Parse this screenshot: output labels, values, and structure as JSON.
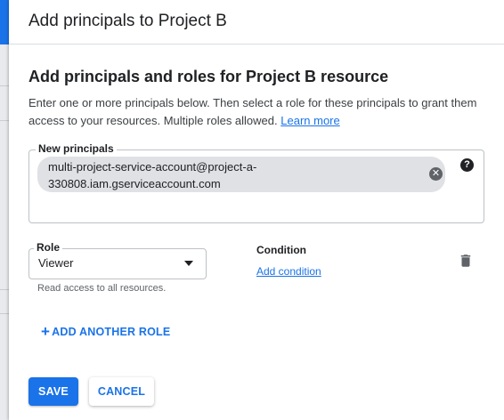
{
  "dialog": {
    "title": "Add principals to Project B"
  },
  "section": {
    "heading": "Add principals and roles for Project B resource",
    "description": "Enter one or more principals below. Then select a role for these principals to grant them access to your resources. Multiple roles allowed.",
    "learn_more": "Learn more"
  },
  "principals": {
    "label": "New principals",
    "chip_value": "multi-project-service-account@project-a-330808.iam.gserviceaccount.com",
    "chip_line1": "multi-project-service-account@project-a-",
    "chip_line2": "330808.iam.gserviceaccount.com",
    "remove_icon": "close-circle-icon",
    "help_icon": "help-icon"
  },
  "role": {
    "label": "Role",
    "value": "Viewer",
    "hint": "Read access to all resources."
  },
  "condition": {
    "label": "Condition",
    "add_link": "Add condition"
  },
  "actions": {
    "add_role": "ADD ANOTHER ROLE",
    "save": "SAVE",
    "cancel": "CANCEL"
  },
  "colors": {
    "accent": "#1a73e8",
    "chip_bg": "#dfe1e5",
    "text": "#202124"
  }
}
